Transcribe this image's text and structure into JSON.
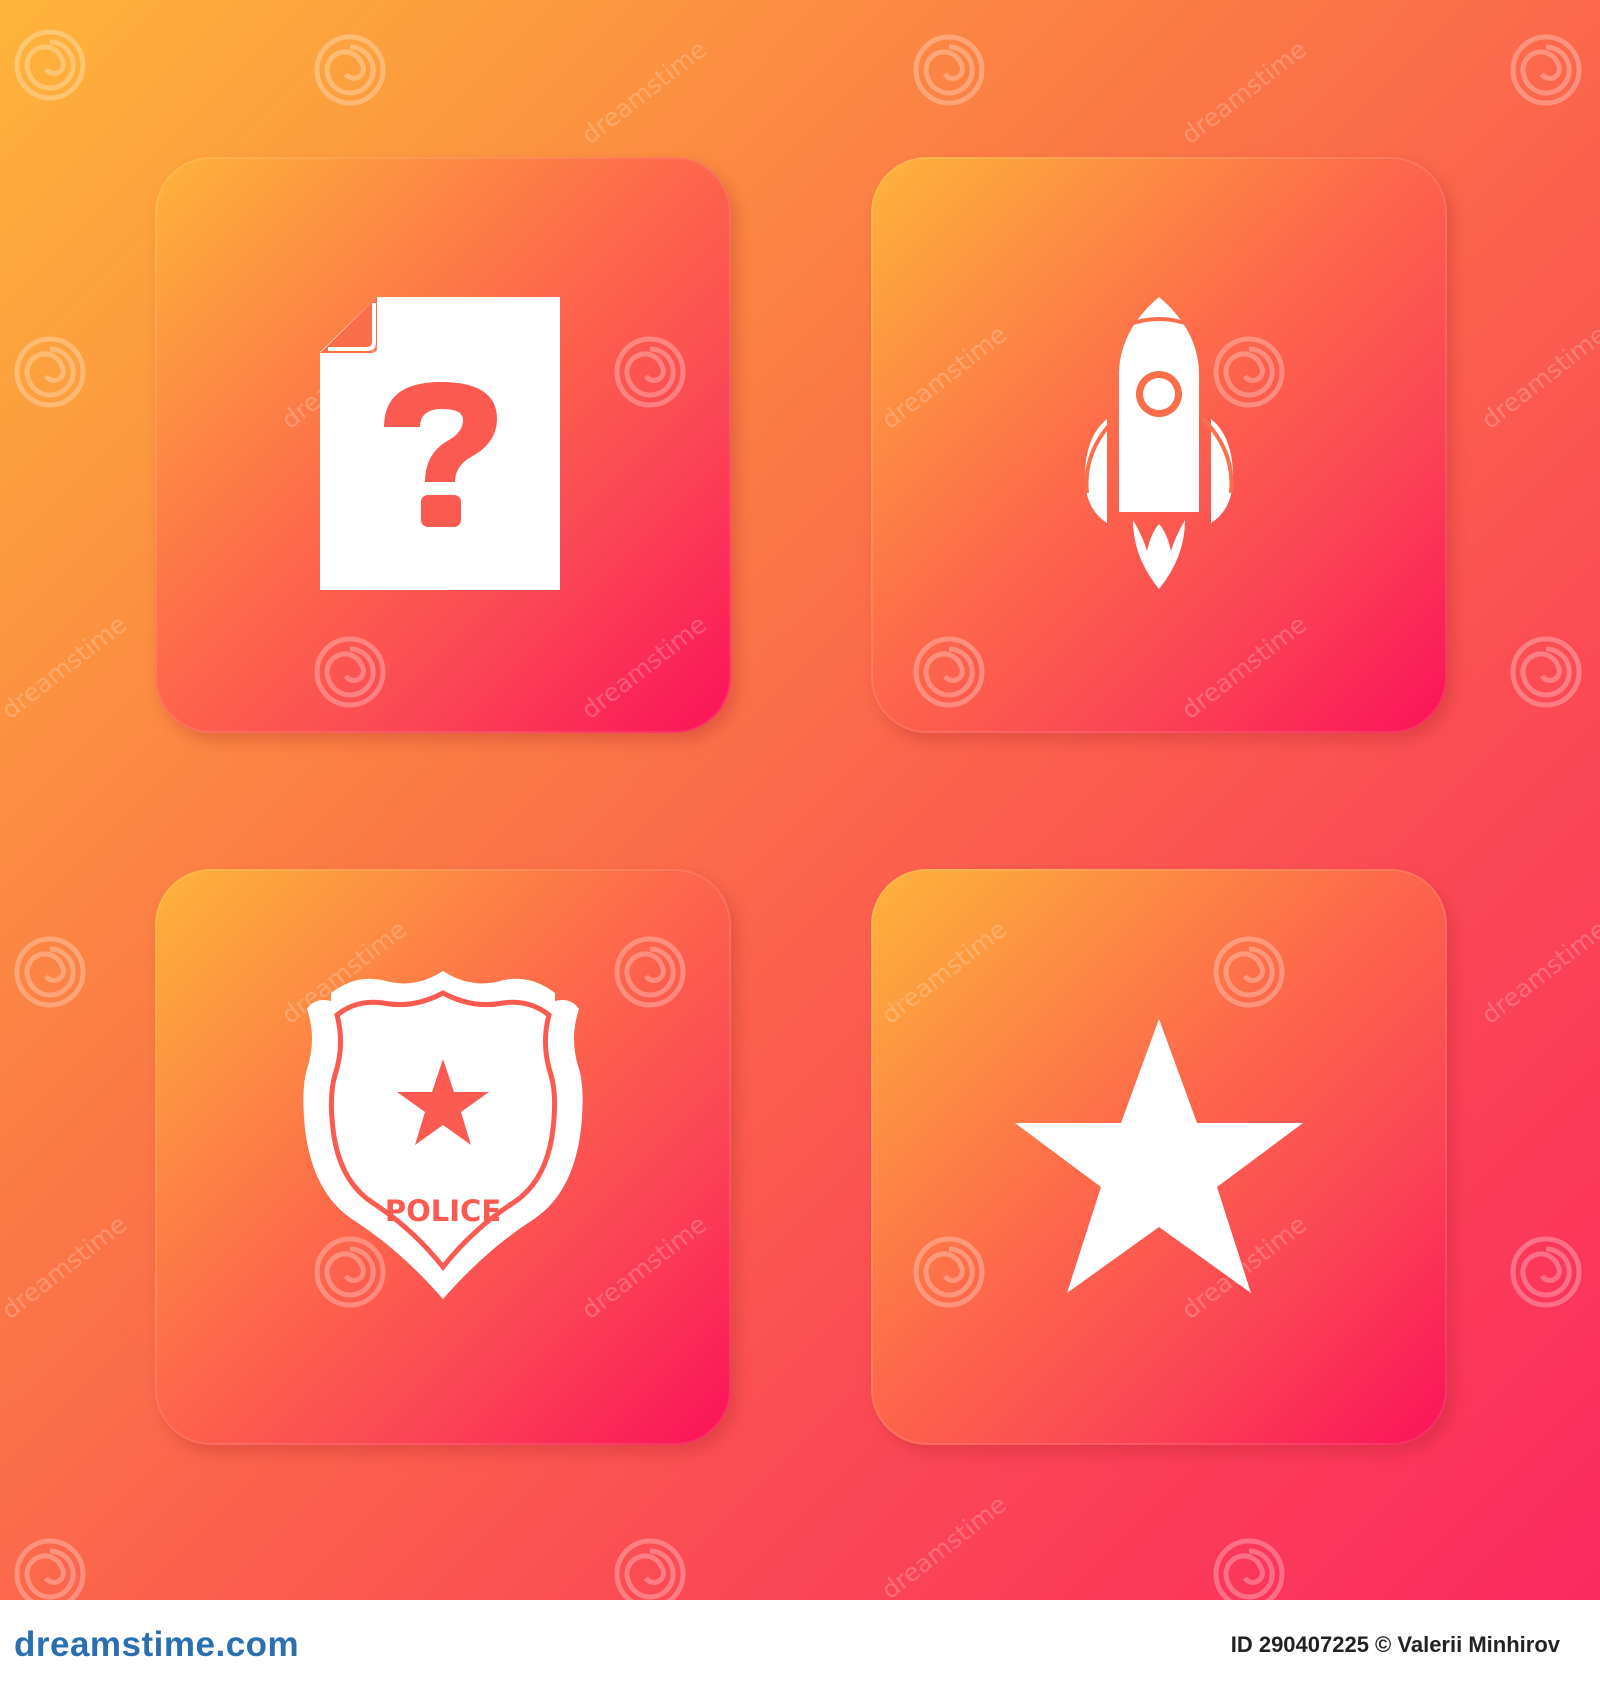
{
  "image": {
    "background_gradient": [
      "#fdb43a",
      "#fb7a45",
      "#fb4b54",
      "#fb2a5f"
    ],
    "tile_gradient": [
      "#fdb43a",
      "#fd6a4a",
      "#fb4555",
      "#fb1258"
    ],
    "icon_color": "#ffffff"
  },
  "tiles": [
    {
      "icon": "document-question-icon"
    },
    {
      "icon": "rocket-icon"
    },
    {
      "icon": "police-badge-icon",
      "badge_text": "POLICE"
    },
    {
      "icon": "star-icon"
    }
  ],
  "watermark": {
    "text": "dreamstime",
    "symbol": "spiral-logo-icon"
  },
  "footer": {
    "logo_text": "dreamstime.com",
    "credit_text": "ID 290407225 © Valerii Minhirov"
  }
}
